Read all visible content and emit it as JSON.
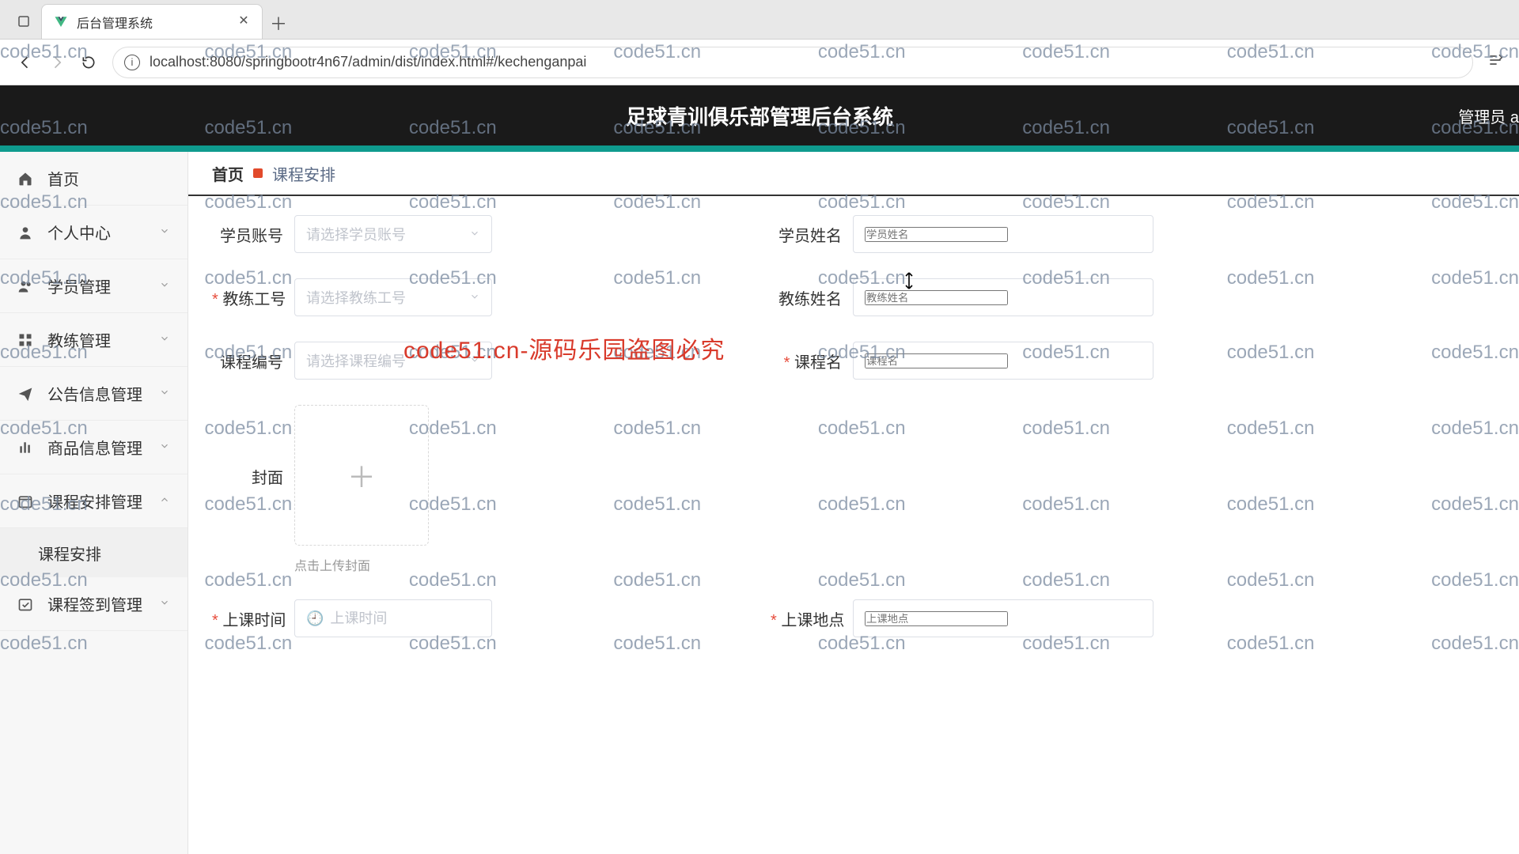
{
  "browser": {
    "tab_title": "后台管理系统",
    "url": "localhost:8080/springbootr4n67/admin/dist/index.html#/kechenganpai"
  },
  "header": {
    "title": "足球青训俱乐部管理后台系统",
    "user_label": "管理员 a"
  },
  "accent_color": "#0f9b8e",
  "sidebar": {
    "items": [
      {
        "icon": "home",
        "label": "首页",
        "expandable": false
      },
      {
        "icon": "user",
        "label": "个人中心",
        "expandable": true,
        "caret": "down"
      },
      {
        "icon": "users",
        "label": "学员管理",
        "expandable": true,
        "caret": "down"
      },
      {
        "icon": "grid",
        "label": "教练管理",
        "expandable": true,
        "caret": "down"
      },
      {
        "icon": "send",
        "label": "公告信息管理",
        "expandable": true,
        "caret": "down"
      },
      {
        "icon": "bars",
        "label": "商品信息管理",
        "expandable": true,
        "caret": "down"
      },
      {
        "icon": "calendar",
        "label": "课程安排管理",
        "expandable": true,
        "caret": "up",
        "children": [
          {
            "label": "课程安排"
          }
        ]
      },
      {
        "icon": "check",
        "label": "课程签到管理",
        "expandable": true,
        "caret": "down"
      }
    ]
  },
  "breadcrumb": {
    "home": "首页",
    "current": "课程安排"
  },
  "form": {
    "student_account": {
      "label": "学员账号",
      "placeholder": "请选择学员账号",
      "required": false,
      "type": "select"
    },
    "student_name": {
      "label": "学员姓名",
      "placeholder": "学员姓名",
      "required": false,
      "type": "text"
    },
    "coach_id": {
      "label": "教练工号",
      "placeholder": "请选择教练工号",
      "required": true,
      "type": "select"
    },
    "coach_name": {
      "label": "教练姓名",
      "placeholder": "教练姓名",
      "required": false,
      "type": "text"
    },
    "course_no": {
      "label": "课程编号",
      "placeholder": "请选择课程编号",
      "required": false,
      "type": "select"
    },
    "course_name": {
      "label": "课程名",
      "placeholder": "课程名",
      "required": true,
      "type": "text"
    },
    "cover": {
      "label": "封面",
      "tip": "点击上传封面"
    },
    "class_time": {
      "label": "上课时间",
      "placeholder": "上课时间",
      "required": true,
      "type": "datetime"
    },
    "class_place": {
      "label": "上课地点",
      "placeholder": "上课地点",
      "required": true,
      "type": "text"
    }
  },
  "watermark": {
    "text": "code51.cn",
    "banner": "code51.cn-源码乐园盗图必究"
  }
}
